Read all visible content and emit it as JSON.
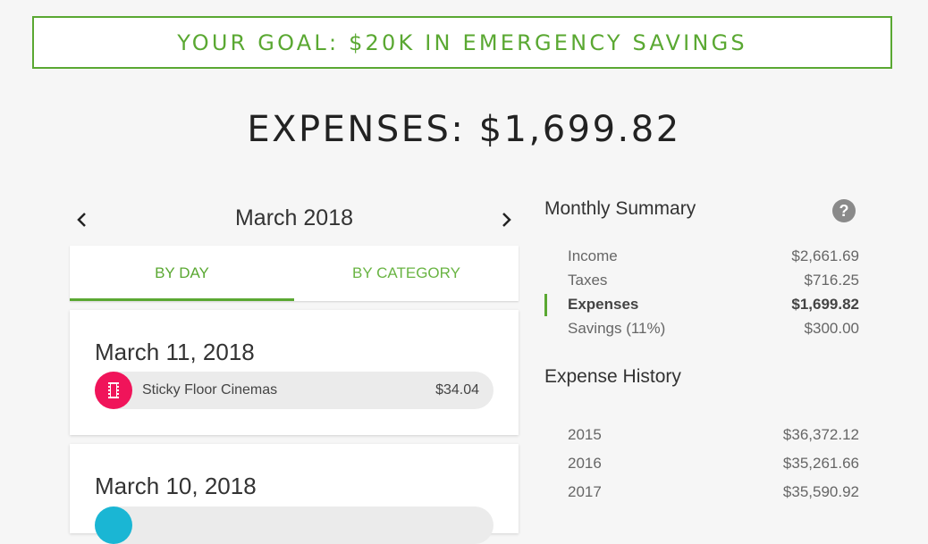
{
  "goal": {
    "text": "YOUR GOAL: $20K IN EMERGENCY SAVINGS"
  },
  "expenses_title": "EXPENSES: $1,699.82",
  "month_nav": {
    "label": "March 2018",
    "prev_icon": "chevron-left",
    "next_icon": "chevron-right"
  },
  "tabs": [
    {
      "label": "BY DAY",
      "active": true
    },
    {
      "label": "BY CATEGORY",
      "active": false
    }
  ],
  "days": [
    {
      "date": "March 11, 2018",
      "transactions": [
        {
          "name": "Sticky Floor Cinemas",
          "amount": "$34.04",
          "icon": "film-icon",
          "color": "#f0145a"
        }
      ]
    },
    {
      "date": "March 10, 2018",
      "transactions": [
        {
          "name": "",
          "amount": "",
          "icon": "category-icon",
          "color": "#1ab6d4"
        }
      ]
    }
  ],
  "monthly_summary": {
    "title": "Monthly Summary",
    "rows": [
      {
        "label": "Income",
        "value": "$2,661.69"
      },
      {
        "label": "Taxes",
        "value": "$716.25"
      },
      {
        "label": "Expenses",
        "value": "$1,699.82",
        "active": true
      },
      {
        "label": "Savings (11%)",
        "value": "$300.00"
      }
    ]
  },
  "expense_history": {
    "title": "Expense History",
    "rows": [
      {
        "label": "2015",
        "value": "$36,372.12"
      },
      {
        "label": "2016",
        "value": "$35,261.66"
      },
      {
        "label": "2017",
        "value": "$35,590.92"
      }
    ]
  },
  "colors": {
    "accent": "#5aa832",
    "pink": "#f0145a",
    "cyan": "#1ab6d4"
  }
}
